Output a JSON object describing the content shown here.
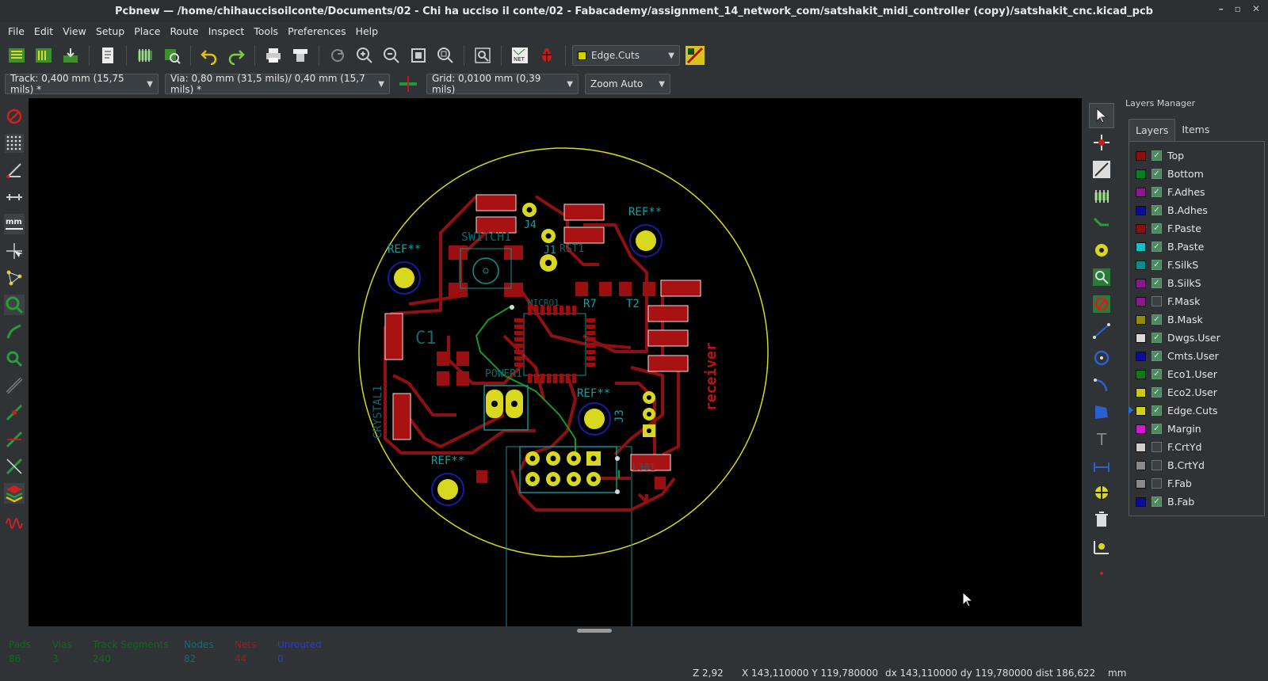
{
  "title": "Pcbnew — /home/chihauccisoilconte/Documents/02 - Chi ha ucciso il conte/02 - Fabacademy/assignment_14_network_com/satshakit_midi_controller (copy)/satshakit_cnc.kicad_pcb",
  "menu": [
    "File",
    "Edit",
    "View",
    "Setup",
    "Place",
    "Route",
    "Inspect",
    "Tools",
    "Preferences",
    "Help"
  ],
  "layer_selector": {
    "value": "Edge.Cuts",
    "color": "#d2d200"
  },
  "track": "Track: 0,400 mm (15,75 mils) *",
  "via": "Via: 0,80 mm (31,5 mils)/ 0,40 mm (15,7 mils) *",
  "grid": "Grid: 0,0100 mm (0,39 mils)",
  "zoom": "Zoom Auto",
  "layers_manager": {
    "title": "Layers Manager",
    "tabs": [
      "Layers",
      "Items"
    ],
    "layers": [
      {
        "name": "Top",
        "color": "#8b0d0d",
        "checked": true
      },
      {
        "name": "Bottom",
        "color": "#0a7d1e",
        "checked": true
      },
      {
        "name": "F.Adhes",
        "color": "#8a1a8a",
        "checked": true
      },
      {
        "name": "B.Adhes",
        "color": "#0b0b9a",
        "checked": true
      },
      {
        "name": "F.Paste",
        "color": "#8a0f0f",
        "checked": true
      },
      {
        "name": "B.Paste",
        "color": "#13c0c6",
        "checked": true
      },
      {
        "name": "F.SilkS",
        "color": "#0f8a8a",
        "checked": true
      },
      {
        "name": "B.SilkS",
        "color": "#8a1a8a",
        "checked": true
      },
      {
        "name": "F.Mask",
        "color": "#8a1a8a",
        "checked": false
      },
      {
        "name": "B.Mask",
        "color": "#8f8a10",
        "checked": true
      },
      {
        "name": "Dwgs.User",
        "color": "#d9d9d9",
        "checked": true
      },
      {
        "name": "Cmts.User",
        "color": "#0b0b9a",
        "checked": true
      },
      {
        "name": "Eco1.User",
        "color": "#0d7a16",
        "checked": true
      },
      {
        "name": "Eco2.User",
        "color": "#c9c91a",
        "checked": true
      },
      {
        "name": "Edge.Cuts",
        "color": "#d2d21a",
        "checked": true,
        "active": true
      },
      {
        "name": "Margin",
        "color": "#d21ad2",
        "checked": true
      },
      {
        "name": "F.CrtYd",
        "color": "#cfcfcf",
        "checked": false
      },
      {
        "name": "B.CrtYd",
        "color": "#8a8a8a",
        "checked": false
      },
      {
        "name": "F.Fab",
        "color": "#8a8a8a",
        "checked": false
      },
      {
        "name": "B.Fab",
        "color": "#0b0b9a",
        "checked": true
      }
    ]
  },
  "stats": [
    {
      "label": "Pads",
      "value": "86",
      "color": "#0d6a18"
    },
    {
      "label": "Vias",
      "value": "3",
      "color": "#0d6a18"
    },
    {
      "label": "Track Segments",
      "value": "240",
      "color": "#0d6a18"
    },
    {
      "label": "Nodes",
      "value": "82",
      "color": "#0d7070"
    },
    {
      "label": "Nets",
      "value": "44",
      "color": "#a11b1b"
    },
    {
      "label": "Unrouted",
      "value": "0",
      "color": "#2a3bd8"
    }
  ],
  "status": {
    "zoom": "Z 2,92",
    "xy": "X 143,110000  Y 119,780000",
    "delta": "dx 143,110000  dy 119,780000  dist 186,622",
    "units": "mm"
  },
  "pcb_labels": {
    "ref1": "REF**",
    "ref2": "REF**",
    "ref3": "REF**",
    "ref4": "REF**",
    "switch": "SWITCH1",
    "rst": "RST1",
    "j1": "J1",
    "j4": "J4",
    "j3": "J3",
    "micro": "MICRO1",
    "r7": "R7",
    "t2": "T2",
    "c1": "C1",
    "power": "POWER1",
    "crystal": "CRYSTAL1",
    "receiver": "receiver",
    "ldo": "L301"
  }
}
